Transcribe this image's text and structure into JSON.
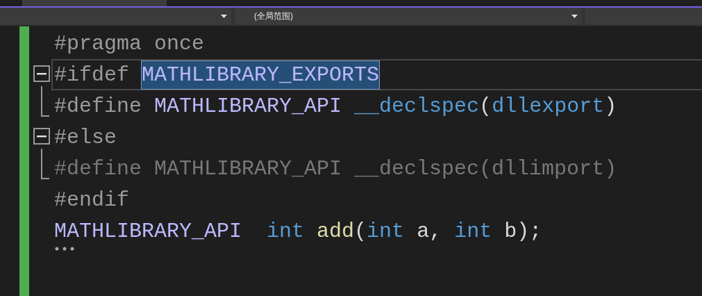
{
  "navigation_bar": {
    "dropdowns": [
      {
        "kind": "select"
      },
      {
        "kind": "select",
        "value": "(全局范围)"
      },
      {
        "kind": "blank"
      }
    ]
  },
  "editor": {
    "lines": [
      {
        "current": false,
        "kind": "plain",
        "tokens": [
          {
            "text": "#pragma once",
            "kind": "directive",
            "selected": false
          }
        ]
      },
      {
        "current": true,
        "kind": "start",
        "tokens": [
          {
            "text": "#ifdef ",
            "kind": "directive",
            "selected": false
          },
          {
            "text": "MATHLIBRARY_EXPORTS",
            "kind": "macro",
            "selected": true
          }
        ]
      },
      {
        "current": false,
        "kind": "end",
        "tokens": [
          {
            "text": "#define ",
            "kind": "directive",
            "selected": false
          },
          {
            "text": "MATHLIBRARY_API ",
            "kind": "macro",
            "selected": false
          },
          {
            "text": "__declspec",
            "kind": "keyword",
            "selected": false
          },
          {
            "text": "(",
            "kind": "plain",
            "selected": false
          },
          {
            "text": "dllexport",
            "kind": "keyword",
            "selected": false
          },
          {
            "text": ")",
            "kind": "plain",
            "selected": false
          }
        ]
      },
      {
        "current": false,
        "kind": "start",
        "tokens": [
          {
            "text": "#else",
            "kind": "directive",
            "selected": false
          }
        ]
      },
      {
        "current": false,
        "kind": "end",
        "tokens": [
          {
            "text": "#define MATHLIBRARY_API __declspec(dllimport)",
            "kind": "inactive",
            "selected": false
          }
        ]
      },
      {
        "current": false,
        "kind": "plain",
        "tokens": [
          {
            "text": "#endif",
            "kind": "directive",
            "selected": false
          }
        ]
      },
      {
        "current": false,
        "kind": "plain",
        "suggestion": true,
        "tokens": [
          {
            "text": "MATHLIBRARY_API  ",
            "kind": "macro",
            "selected": false
          },
          {
            "text": "int ",
            "kind": "keyword",
            "selected": false
          },
          {
            "text": "add",
            "kind": "function",
            "selected": false
          },
          {
            "text": "(",
            "kind": "plain",
            "selected": false
          },
          {
            "text": "int ",
            "kind": "keyword",
            "selected": false
          },
          {
            "text": "a, ",
            "kind": "plain",
            "selected": false
          },
          {
            "text": "int ",
            "kind": "keyword",
            "selected": false
          },
          {
            "text": "b);",
            "kind": "plain",
            "selected": false
          }
        ]
      }
    ]
  }
}
